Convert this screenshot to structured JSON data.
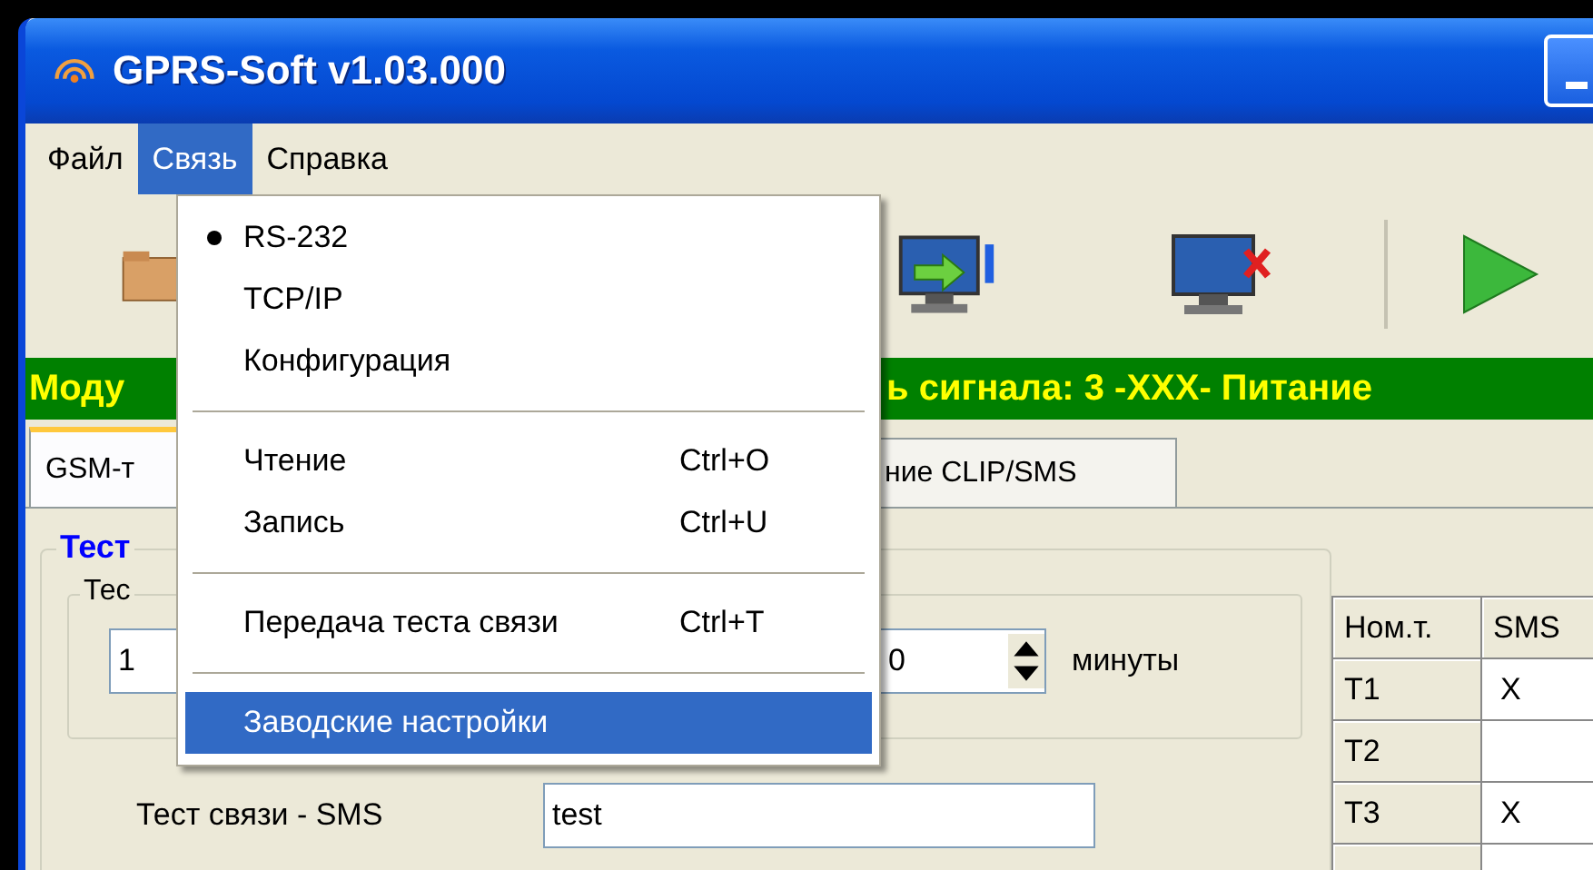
{
  "window": {
    "title": "GPRS-Soft v1.03.000"
  },
  "menu_bar": [
    {
      "label": "Файл",
      "selected": false
    },
    {
      "label": "Связь",
      "selected": true
    },
    {
      "label": "Справка",
      "selected": false
    }
  ],
  "dropdown": [
    {
      "kind": "item",
      "label": "RS-232",
      "checked": true,
      "highlighted": false
    },
    {
      "kind": "item",
      "label": "TCP/IP",
      "checked": false,
      "highlighted": false
    },
    {
      "kind": "item",
      "label": "Конфигурация",
      "checked": false,
      "highlighted": false
    },
    {
      "kind": "separator"
    },
    {
      "kind": "item",
      "label": "Чтение",
      "shortcut": "Ctrl+O",
      "checked": false,
      "highlighted": false
    },
    {
      "kind": "item",
      "label": "Запись",
      "shortcut": "Ctrl+U",
      "checked": false,
      "highlighted": false
    },
    {
      "kind": "separator"
    },
    {
      "kind": "item",
      "label": "Передача теста связи",
      "shortcut": "Ctrl+T",
      "checked": false,
      "highlighted": false
    },
    {
      "kind": "separator"
    },
    {
      "kind": "item",
      "label": "Заводские настройки",
      "checked": false,
      "highlighted": true
    }
  ],
  "status_bar": {
    "left": "Моду",
    "right": "ь сигнала: 3 -XXX-  Питание"
  },
  "tabs": [
    {
      "label": "GSM-т",
      "selected": true
    },
    {
      "label": "ние CLIP/SMS",
      "selected": false
    }
  ],
  "group": {
    "legend": "Тест",
    "inner_legend": "Тес",
    "field_value": "1",
    "spinner_value": "0",
    "spinner_unit": "минуты",
    "sms_label": "Тест связи - SMS",
    "sms_value": "test"
  },
  "table": {
    "columns": [
      "Ном.т.",
      "SMS"
    ],
    "rows": [
      {
        "label": "T1",
        "sms": "X"
      },
      {
        "label": "T2",
        "sms": ""
      },
      {
        "label": "T3",
        "sms": "X"
      }
    ]
  }
}
